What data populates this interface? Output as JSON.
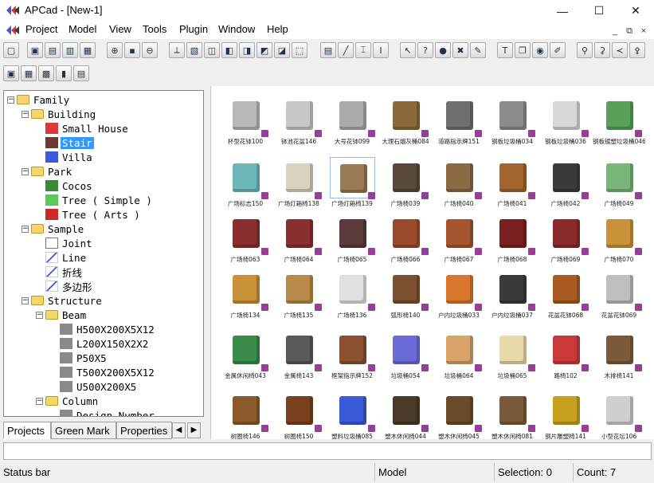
{
  "window": {
    "title": "APCad - [New-1]"
  },
  "window_controls": {
    "minimize": "—",
    "maximize": "☐",
    "close": "✕"
  },
  "menu": [
    "Project",
    "Model",
    "View",
    "Tools",
    "Plugin",
    "Window",
    "Help"
  ],
  "mdi_controls": [
    "_",
    "⧉",
    "×"
  ],
  "toolbar1_icons": [
    "new-file",
    "new-window",
    "layout-1",
    "layout-2",
    "layout-3",
    "zoom-in",
    "save",
    "zoom-out",
    "axis",
    "view-3d",
    "view-front",
    "view-back",
    "view-left",
    "view-right",
    "view-top",
    "view-bottom",
    "properties",
    "line-tool",
    "dimension",
    "section",
    "select",
    "help-cursor",
    "green-mark",
    "erase",
    "pen",
    "text-tool",
    "copy",
    "globe",
    "palette",
    "tree-1",
    "tree-2",
    "share",
    "tree-3"
  ],
  "toolbar1_glyphs": [
    "▢",
    "▣",
    "▤",
    "▥",
    "▦",
    "⊕",
    "▪",
    "⊖",
    "⟂",
    "▧",
    "◫",
    "◧",
    "◨",
    "◩",
    "◪",
    "⬚",
    "▤",
    "╱",
    "⌶",
    "Ⅰ",
    "↖",
    "?",
    "●",
    "✖",
    "✎",
    "T",
    "❐",
    "◉",
    "✐",
    "⚲",
    "⚳",
    "≺",
    "⚴"
  ],
  "toolbar2_icons": [
    "open",
    "save",
    "image",
    "lock",
    "delete"
  ],
  "toolbar2_glyphs": [
    "▣",
    "▦",
    "▩",
    "▮",
    "▤"
  ],
  "tree": [
    {
      "label": "Family",
      "level": 0,
      "expander": "−",
      "icon": "folder"
    },
    {
      "label": "Building",
      "level": 1,
      "expander": "−",
      "icon": "folder"
    },
    {
      "label": "Small House",
      "level": 2,
      "icon": "house"
    },
    {
      "label": "Stair",
      "level": 2,
      "icon": "stair",
      "selected": true
    },
    {
      "label": "Villa",
      "level": 2,
      "icon": "villa"
    },
    {
      "label": "Park",
      "level": 1,
      "expander": "−",
      "icon": "folder"
    },
    {
      "label": "Cocos",
      "level": 2,
      "icon": "palm"
    },
    {
      "label": "Tree ( Simple )",
      "level": 2,
      "icon": "tree"
    },
    {
      "label": "Tree ( Arts )",
      "level": 2,
      "icon": "tree-arts"
    },
    {
      "label": "Sample",
      "level": 1,
      "expander": "−",
      "icon": "folder"
    },
    {
      "label": "Joint",
      "level": 2,
      "icon": "document"
    },
    {
      "label": "Line",
      "level": 2,
      "icon": "line"
    },
    {
      "label": "折线",
      "level": 2,
      "icon": "line"
    },
    {
      "label": "多边形",
      "level": 2,
      "icon": "line"
    },
    {
      "label": "Structure",
      "level": 1,
      "expander": "−",
      "icon": "folder"
    },
    {
      "label": "Beam",
      "level": 2,
      "expander": "−",
      "icon": "folder"
    },
    {
      "label": "H500X200X5X12",
      "level": 3,
      "icon": "beam"
    },
    {
      "label": "L200X150X2X2",
      "level": 3,
      "icon": "beam"
    },
    {
      "label": "P50X5",
      "level": 3,
      "icon": "beam"
    },
    {
      "label": "T500X200X5X12",
      "level": 3,
      "icon": "beam"
    },
    {
      "label": "U500X200X5",
      "level": 3,
      "icon": "beam"
    },
    {
      "label": "Column",
      "level": 2,
      "expander": "−",
      "icon": "folder"
    },
    {
      "label": "Design Number",
      "level": 3,
      "icon": "beam"
    }
  ],
  "tabs": [
    "Projects",
    "Green Mark",
    "Properties"
  ],
  "tab_arrows": [
    "◀",
    "▶"
  ],
  "items": [
    {
      "caption": "杯型花钵100",
      "color": "#b8b8b8"
    },
    {
      "caption": "钵池花盆146",
      "color": "#c8c8c8"
    },
    {
      "caption": "大号花钵099",
      "color": "#aaaaaa"
    },
    {
      "caption": "大理石烟灰桶084",
      "color": "#8a6a3a"
    },
    {
      "caption": "道路指示牌151",
      "color": "#6f6f6f"
    },
    {
      "caption": "钢板垃圾桶034",
      "color": "#8c8c8c"
    },
    {
      "caption": "钢板垃圾桶036",
      "color": "#d8d8d8"
    },
    {
      "caption": "钢板镀塑垃圾桶046",
      "color": "#5aa05a"
    },
    {
      "caption": "广场标志150",
      "color": "#6fb8b8"
    },
    {
      "caption": "广场灯箱椅138",
      "color": "#d9d2c0"
    },
    {
      "caption": "广场灯箱椅139",
      "color": "#9a7a55"
    },
    {
      "caption": "广场椅039",
      "color": "#5a4a3a"
    },
    {
      "caption": "广场椅040",
      "color": "#8b6a45"
    },
    {
      "caption": "广场椅041",
      "color": "#a2652e"
    },
    {
      "caption": "广场椅042",
      "color": "#3a3a3a"
    },
    {
      "caption": "广场椅049",
      "color": "#7ab57a"
    },
    {
      "caption": "广场椅063",
      "color": "#8a2f2f"
    },
    {
      "caption": "广场椅064",
      "color": "#8a2f2f"
    },
    {
      "caption": "广场椅065",
      "color": "#5a3a3a"
    },
    {
      "caption": "广场椅066",
      "color": "#9a4a2a"
    },
    {
      "caption": "广场椅067",
      "color": "#a5552e"
    },
    {
      "caption": "广场椅068",
      "color": "#7a2020"
    },
    {
      "caption": "广场椅069",
      "color": "#8a2a2a"
    },
    {
      "caption": "广场椅070",
      "color": "#c8913a"
    },
    {
      "caption": "广场椅134",
      "color": "#c8913a"
    },
    {
      "caption": "广场椅135",
      "color": "#b88a4a"
    },
    {
      "caption": "广场椅136",
      "color": "#e0e0e0"
    },
    {
      "caption": "弧形椅140",
      "color": "#7a5030"
    },
    {
      "caption": "户内垃圾桶033",
      "color": "#d9762e"
    },
    {
      "caption": "户内垃圾桶037",
      "color": "#3a3a3a"
    },
    {
      "caption": "花盆花钵068",
      "color": "#a85a20"
    },
    {
      "caption": "花盆花钵069",
      "color": "#bfbfbf"
    },
    {
      "caption": "金属休闲椅043",
      "color": "#3a8a4a"
    },
    {
      "caption": "金属椅143",
      "color": "#5a5a5a"
    },
    {
      "caption": "框架指示牌152",
      "color": "#8a5030"
    },
    {
      "caption": "垃圾桶054",
      "color": "#6a6ad8"
    },
    {
      "caption": "垃圾桶064",
      "color": "#d9a36a"
    },
    {
      "caption": "垃圾桶065",
      "color": "#e8d9a8"
    },
    {
      "caption": "路椅102",
      "color": "#c83a3a"
    },
    {
      "caption": "木排椅141",
      "color": "#7a5a3a"
    },
    {
      "caption": "树圈椅146",
      "color": "#8a5a2a"
    },
    {
      "caption": "树圈椅150",
      "color": "#7a4020"
    },
    {
      "caption": "塑料垃圾桶085",
      "color": "#3a5ad8"
    },
    {
      "caption": "塑木休闲椅044",
      "color": "#4a3a2a"
    },
    {
      "caption": "塑木休闲椅045",
      "color": "#6a4a2a"
    },
    {
      "caption": "塑木休闲椅081",
      "color": "#7a5a3a"
    },
    {
      "caption": "钢片雕塑椅141",
      "color": "#c8a020"
    },
    {
      "caption": "小型花坛106",
      "color": "#cfcfcf"
    }
  ],
  "status": {
    "text": "Status bar",
    "mode": "Model",
    "selection": "Selection: 0",
    "count": "Count: 7"
  }
}
